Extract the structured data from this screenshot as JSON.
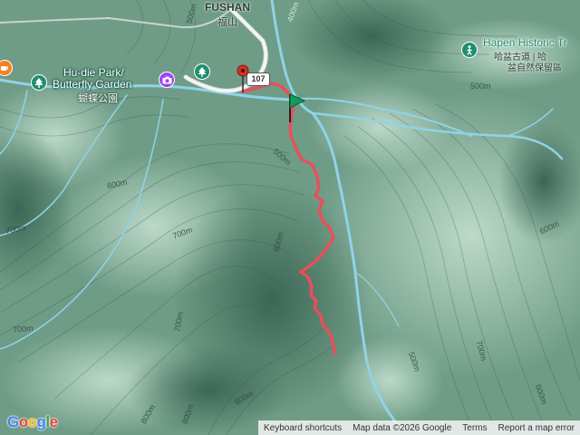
{
  "labels": {
    "fushan_en": "FUSHAN",
    "fushan_zh": "福山",
    "hudie_line1": "Hu-die Park/",
    "hudie_line2": "Butterfly Garden",
    "hudie_zh": "蝴蝶公園",
    "hapen_name": "Hapen Historic Tr",
    "hapen_zh1": "哈盆古道 | 哈",
    "hapen_zh2": "盆自然保留區",
    "route_shield": "107"
  },
  "contours": [
    "500m",
    "400m",
    "500m",
    "600m",
    "700m",
    "500m",
    "600m",
    "700m",
    "600m",
    "700m",
    "700m",
    "700m",
    "800m",
    "600m",
    "500m",
    "800m",
    "600m"
  ],
  "attribution": {
    "keyboard": "Keyboard shortcuts",
    "map_data": "Map data ©2026 Google",
    "terms": "Terms",
    "report": "Report a map error"
  },
  "logo": "Google",
  "colors": {
    "terrain_dark": "#4f7d68",
    "terrain_light": "#a9cbb9",
    "river": "#8fd3e8",
    "track": "#e8505b",
    "start_marker": "#0f9d58",
    "end_marker": "#d93025",
    "poi_green": "#1e8e6e",
    "poi_purple": "#a142f4",
    "poi_orange": "#f4811f"
  }
}
